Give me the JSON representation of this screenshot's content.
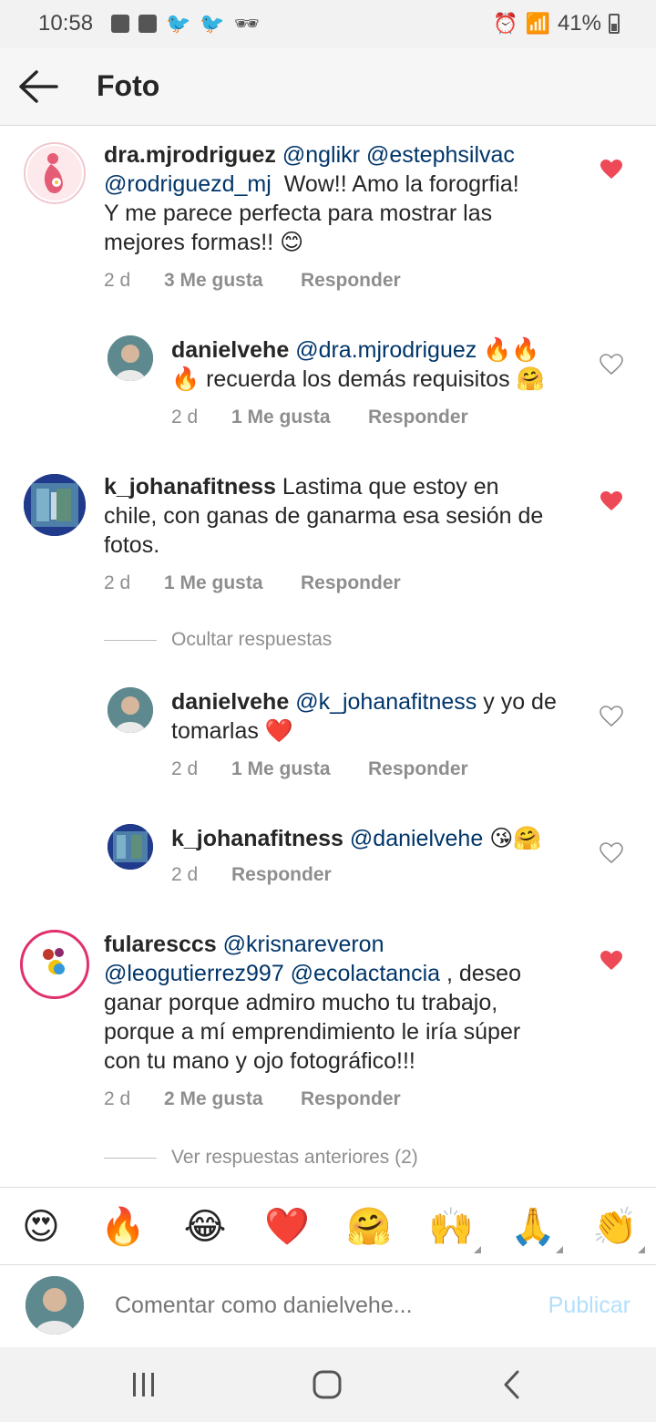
{
  "status_bar": {
    "time": "10:58",
    "battery": "41%"
  },
  "app_bar": {
    "title": "Foto"
  },
  "comments": [
    {
      "user": "dra.mjrodriguez",
      "mentions": [
        "@nglikr",
        "@estephsilvac",
        "@rodriguezd_mj"
      ],
      "text_lines": [
        "Wow!! Amo la forogrfia!",
        "Y me parece perfecta para mostrar las",
        "mejores formas!! 😊"
      ],
      "time": "2 d",
      "likes": "3 Me gusta",
      "reply": "Responder",
      "liked": true
    },
    {
      "user": "danielvehe",
      "mentions": [
        "@dra.mjrodriguez"
      ],
      "text_lines": [
        "🔥🔥",
        "🔥 recuerda los demás requisitos 🤗"
      ],
      "time": "2 d",
      "likes": "1 Me gusta",
      "reply": "Responder",
      "liked": false
    },
    {
      "user": "k_johanafitness",
      "text_lines": [
        "Lastima que estoy en",
        "chile, con ganas de ganarma esa sesión de",
        "fotos."
      ],
      "time": "2 d",
      "likes": "1 Me gusta",
      "reply": "Responder",
      "liked": true
    },
    {
      "user": "danielvehe",
      "mentions": [
        "@k_johanafitness"
      ],
      "text_lines": [
        "y yo de",
        "tomarlas ❤️"
      ],
      "time": "2 d",
      "likes": "1 Me gusta",
      "reply": "Responder",
      "liked": false
    },
    {
      "user": "k_johanafitness",
      "mentions": [
        "@danielvehe"
      ],
      "text_lines": [
        "😘🤗"
      ],
      "time": "2 d",
      "reply": "Responder",
      "liked": false
    },
    {
      "user": "fularesccs",
      "mentions": [
        "@krisnareveron",
        "@leogutierrez997",
        "@ecolactancia"
      ],
      "text_lines": [
        ", deseo",
        "ganar porque admiro mucho tu trabajo,",
        "porque a mí emprendimiento le iría súper",
        "con tu mano y ojo fotográfico!!!"
      ],
      "time": "2 d",
      "likes": "2 Me gusta",
      "reply": "Responder",
      "liked": true
    }
  ],
  "hide_replies": "Ocultar respuestas",
  "view_previous": "Ver respuestas anteriores (2)",
  "emoji_bar": [
    "😍",
    "🔥",
    "😂",
    "❤️",
    "🤗",
    "🙌",
    "🙏",
    "👏"
  ],
  "input": {
    "placeholder": "Comentar como danielvehe...",
    "post_label": "Publicar"
  },
  "colors": {
    "heart_liked": "#ed4956",
    "mention": "#003569",
    "meta": "#8e8e8e",
    "post_disabled": "#b2dffc"
  }
}
